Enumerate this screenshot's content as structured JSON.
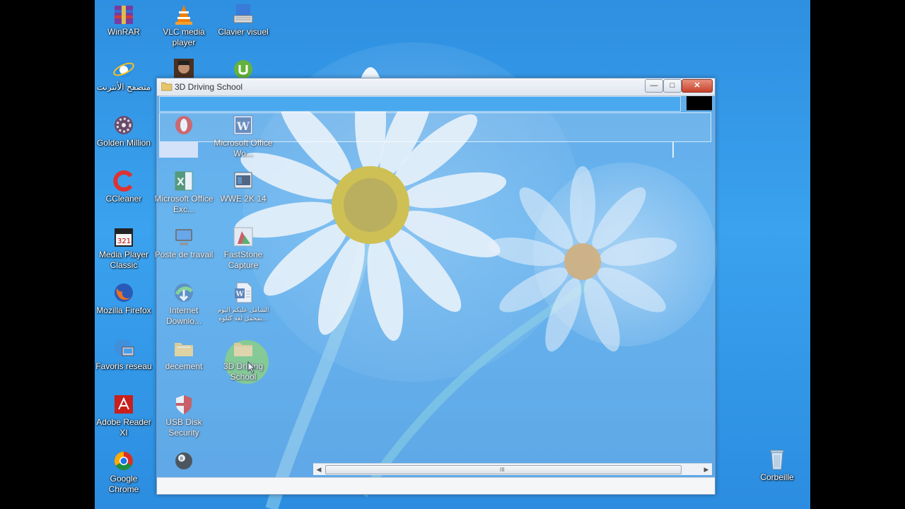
{
  "desktop_icons": [
    {
      "name": "winrar-icon",
      "label": "WinRAR"
    },
    {
      "name": "vlc-icon",
      "label": "VLC media player"
    },
    {
      "name": "keyboard-icon",
      "label": "Clavier visuel"
    },
    {
      "name": "internet-explorer-icon",
      "label": "متصفح الأنترنت"
    },
    {
      "name": "game-character-icon",
      "label": ""
    },
    {
      "name": "utorrent-icon",
      "label": ""
    },
    {
      "name": "golden-million-icon",
      "label": "Golden Million"
    },
    {
      "name": "opera-icon",
      "label": ""
    },
    {
      "name": "word-icon",
      "label": "Microsoft Office Wo..."
    },
    {
      "name": "ccleaner-icon",
      "label": "CCleaner"
    },
    {
      "name": "excel-icon",
      "label": "Microsoft Office Exc..."
    },
    {
      "name": "wwe-icon",
      "label": "WWE 2K 14"
    },
    {
      "name": "media-player-classic-icon",
      "label": "Media Player Classic"
    },
    {
      "name": "computer-icon",
      "label": "Poste de travail"
    },
    {
      "name": "faststone-icon",
      "label": "FastStone Capture"
    },
    {
      "name": "firefox-icon",
      "label": "Mozilla Firefox"
    },
    {
      "name": "idm-icon",
      "label": "Internet Downlo..."
    },
    {
      "name": "word-doc-icon",
      "label": "الشامل عليكم اليوم بمحمل لغة كتلوه..."
    },
    {
      "name": "network-icon",
      "label": "Favoris reseau"
    },
    {
      "name": "folder-icon",
      "label": "decement"
    },
    {
      "name": "folder-icon",
      "label": "3D Driving School"
    },
    {
      "name": "adobe-reader-icon",
      "label": "Adobe Reader XI"
    },
    {
      "name": "usb-security-icon",
      "label": "USB Disk Security"
    },
    {
      "name": "chrome-icon",
      "label": "Google Chrome"
    },
    {
      "name": "billiard-ball-icon",
      "label": ""
    },
    {
      "name": "recycle-bin-icon",
      "label": "Corbeille"
    }
  ],
  "window": {
    "title": "3D Driving School",
    "minimize": "—",
    "maximize": "□",
    "close": "✕",
    "scroll_left": "◀",
    "scroll_right": "▶",
    "scroll_grip": "III"
  },
  "colors": {
    "desktop_blue": "#3aa2ef",
    "selection": "#4aa9ee"
  }
}
